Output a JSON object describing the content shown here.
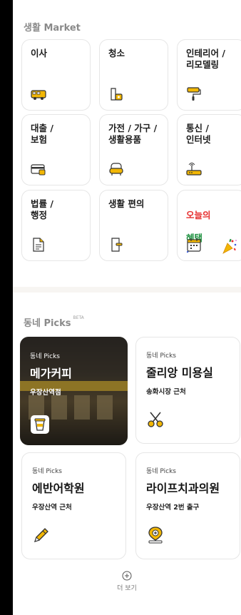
{
  "market": {
    "title": "생활 Market",
    "cards": [
      {
        "label": "이사",
        "icon": "moving-truck-icon"
      },
      {
        "label": "청소",
        "icon": "cleaning-icon"
      },
      {
        "label": "인테리어 /\n리모델링",
        "icon": "paint-roller-icon"
      },
      {
        "label": "대출 /\n보험",
        "icon": "card-icon"
      },
      {
        "label": "가전 / 가구 /\n생활용품",
        "icon": "sofa-icon"
      },
      {
        "label": "통신 /\n인터넷",
        "icon": "router-icon"
      },
      {
        "label": "법률 /\n행정",
        "icon": "document-icon"
      },
      {
        "label": "생활 편의",
        "icon": "door-icon"
      }
    ],
    "benefit": {
      "line1": "오늘의",
      "line2": "혜택",
      "mark": "!",
      "icon": "calendar-icon",
      "extra_icon": "party-popper-icon"
    }
  },
  "picks": {
    "title": "동네 Picks",
    "badge": "BETA",
    "items": [
      {
        "kicker": "동네 Picks",
        "name": "메가커피",
        "location": "우장산역점",
        "icon": "coffee-cup-icon",
        "featured": true
      },
      {
        "kicker": "동네 Picks",
        "name": "줄리앙 미용실",
        "location": "송화시장 근처",
        "icon": "scissors-icon"
      },
      {
        "kicker": "동네 Picks",
        "name": "에반어학원",
        "location": "우장산역 근처",
        "icon": "pencil-icon"
      },
      {
        "kicker": "동네 Picks",
        "name": "라이프치과의원",
        "location": "우장산역 2번 출구",
        "icon": "dental-clinic-icon"
      }
    ],
    "more_label": "더 보기"
  },
  "colors": {
    "accent": "#f2b705",
    "icon_dark": "#333333",
    "divider": "#f7f5f2"
  }
}
